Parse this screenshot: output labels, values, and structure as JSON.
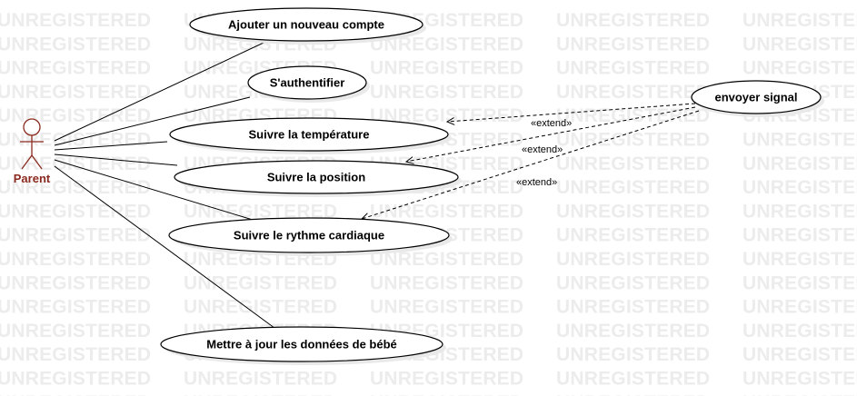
{
  "watermark": {
    "text": "UNREGISTERED",
    "color": "#ececec"
  },
  "actor": {
    "name": "Parent",
    "color": "#8b2a1f"
  },
  "use_cases": [
    {
      "id": "uc-ajouter",
      "label": "Ajouter un nouveau compte"
    },
    {
      "id": "uc-authentifier",
      "label": "S'authentifier"
    },
    {
      "id": "uc-temperature",
      "label": "Suivre la température"
    },
    {
      "id": "uc-position",
      "label": "Suivre la position"
    },
    {
      "id": "uc-rythme",
      "label": "Suivre le rythme cardiaque"
    },
    {
      "id": "uc-mettre-a-jour",
      "label": "Mettre à jour les données de bébé"
    },
    {
      "id": "uc-envoyer-signal",
      "label": "envoyer signal"
    }
  ],
  "extends": [
    {
      "from": "uc-envoyer-signal",
      "to": "uc-temperature",
      "stereotype": "«extend»"
    },
    {
      "from": "uc-envoyer-signal",
      "to": "uc-position",
      "stereotype": "«extend»"
    },
    {
      "from": "uc-envoyer-signal",
      "to": "uc-rythme",
      "stereotype": "«extend»"
    }
  ],
  "associations": [
    {
      "from": "actor",
      "to": "uc-ajouter"
    },
    {
      "from": "actor",
      "to": "uc-authentifier"
    },
    {
      "from": "actor",
      "to": "uc-temperature"
    },
    {
      "from": "actor",
      "to": "uc-position"
    },
    {
      "from": "actor",
      "to": "uc-rythme"
    },
    {
      "from": "actor",
      "to": "uc-mettre-a-jour"
    }
  ]
}
